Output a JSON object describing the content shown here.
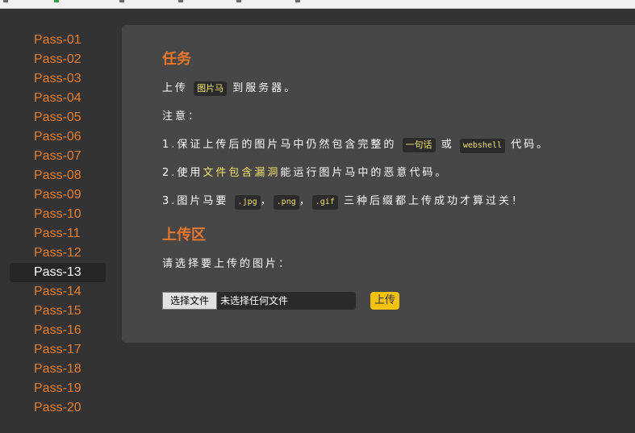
{
  "sidebar": {
    "items": [
      {
        "label": "Pass-01"
      },
      {
        "label": "Pass-02"
      },
      {
        "label": "Pass-03"
      },
      {
        "label": "Pass-04"
      },
      {
        "label": "Pass-05"
      },
      {
        "label": "Pass-06"
      },
      {
        "label": "Pass-07"
      },
      {
        "label": "Pass-08"
      },
      {
        "label": "Pass-09"
      },
      {
        "label": "Pass-10"
      },
      {
        "label": "Pass-11"
      },
      {
        "label": "Pass-12"
      },
      {
        "label": "Pass-13",
        "active": true
      },
      {
        "label": "Pass-14"
      },
      {
        "label": "Pass-15"
      },
      {
        "label": "Pass-16"
      },
      {
        "label": "Pass-17"
      },
      {
        "label": "Pass-18"
      },
      {
        "label": "Pass-19"
      },
      {
        "label": "Pass-20"
      }
    ]
  },
  "task": {
    "title": "任务",
    "line1_pre": "上传",
    "line1_code": "图片马",
    "line1_post": "到服务器。",
    "notice": "注意：",
    "line2_pre": "1.保证上传后的图片马中仍然包含完整的",
    "line2_code1": "一句话",
    "line2_mid": "或",
    "line2_code2": "webshell",
    "line2_post": "代码。",
    "line3_pre": "2.使用",
    "line3_hl": "文件包含漏洞",
    "line3_post": "能运行图片马中的恶意代码。",
    "line4_pre": "3.图片马要",
    "line4_code1": ".jpg",
    "line4_sep1": "，",
    "line4_code2": ".png",
    "line4_sep2": "，",
    "line4_code3": ".gif",
    "line4_post": "三种后缀都上传成功才算过关！"
  },
  "upload": {
    "title": "上传区",
    "prompt": "请选择要上传的图片：",
    "file_button": "选择文件",
    "file_status": "未选择任何文件",
    "submit": "上传"
  },
  "colors": {
    "accent": "#e8762c",
    "link": "#ef7f2a",
    "highlight": "#f2e06a",
    "button": "#f4c20d",
    "background": "#333333",
    "panel": "#474747"
  }
}
